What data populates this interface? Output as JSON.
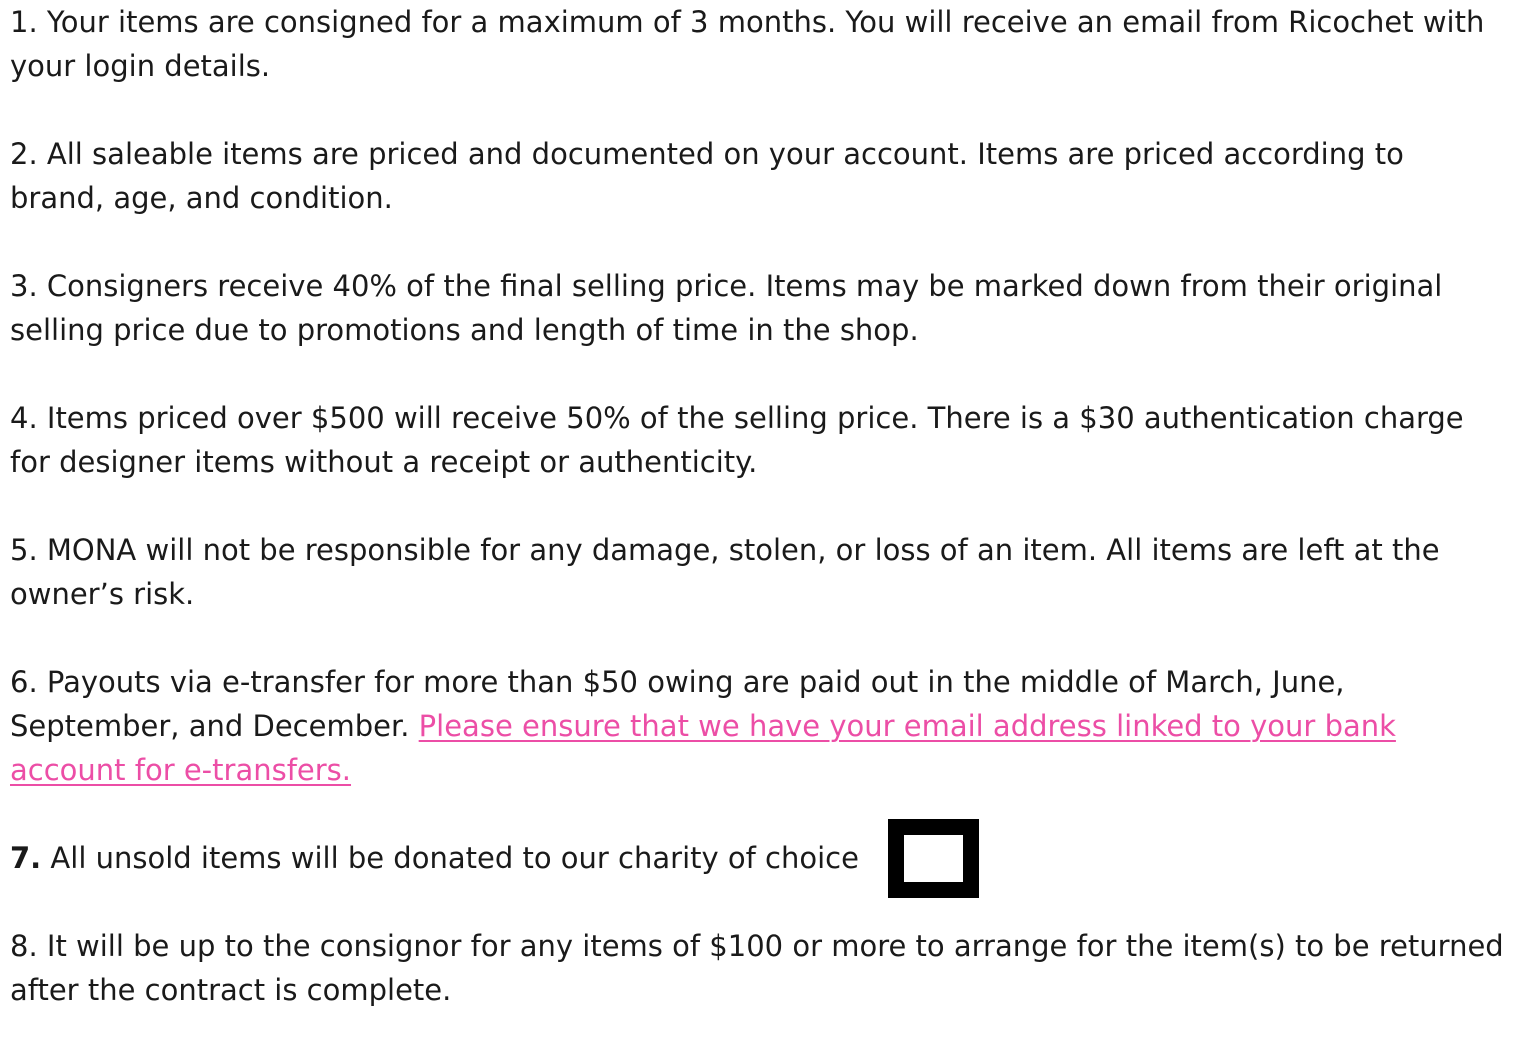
{
  "terms": {
    "t1": "1. Your items are consigned for a maximum of 3 months. You will receive an email from Ricochet with your login details.",
    "t2": "2. All saleable items are priced and documented on your account. Items are priced according to brand, age, and condition.",
    "t3": "3. Consigners receive 40% of the final selling price. Items may be marked down from their original selling price due to promotions and length of time in the shop.",
    "t4": "4. Items priced over $500 will receive 50% of the selling price. There is a $30 authentication charge for designer items without a receipt or authenticity.",
    "t5": "5. MONA will not be responsible for any damage, stolen, or loss of an item. All items are left at the owner’s risk.",
    "t6_text": "6. Payouts via e-transfer for more than $50 owing are paid out in the middle of March, June, September, and December.",
    "t6_link": "Please ensure that we have your email address linked to your bank account for e-transfers.",
    "t7_number": "7.",
    "t7_text": "All unsold items will be donated to our charity of choice",
    "t8": "8. It will be up to the consignor for any items of $100 or more to arrange for the item(s) to be returned after the contract is complete."
  },
  "colors": {
    "link": "#ec4ea6",
    "text": "#1a1a1a",
    "checkbox_border": "#000000"
  },
  "checkbox_state": "unchecked"
}
